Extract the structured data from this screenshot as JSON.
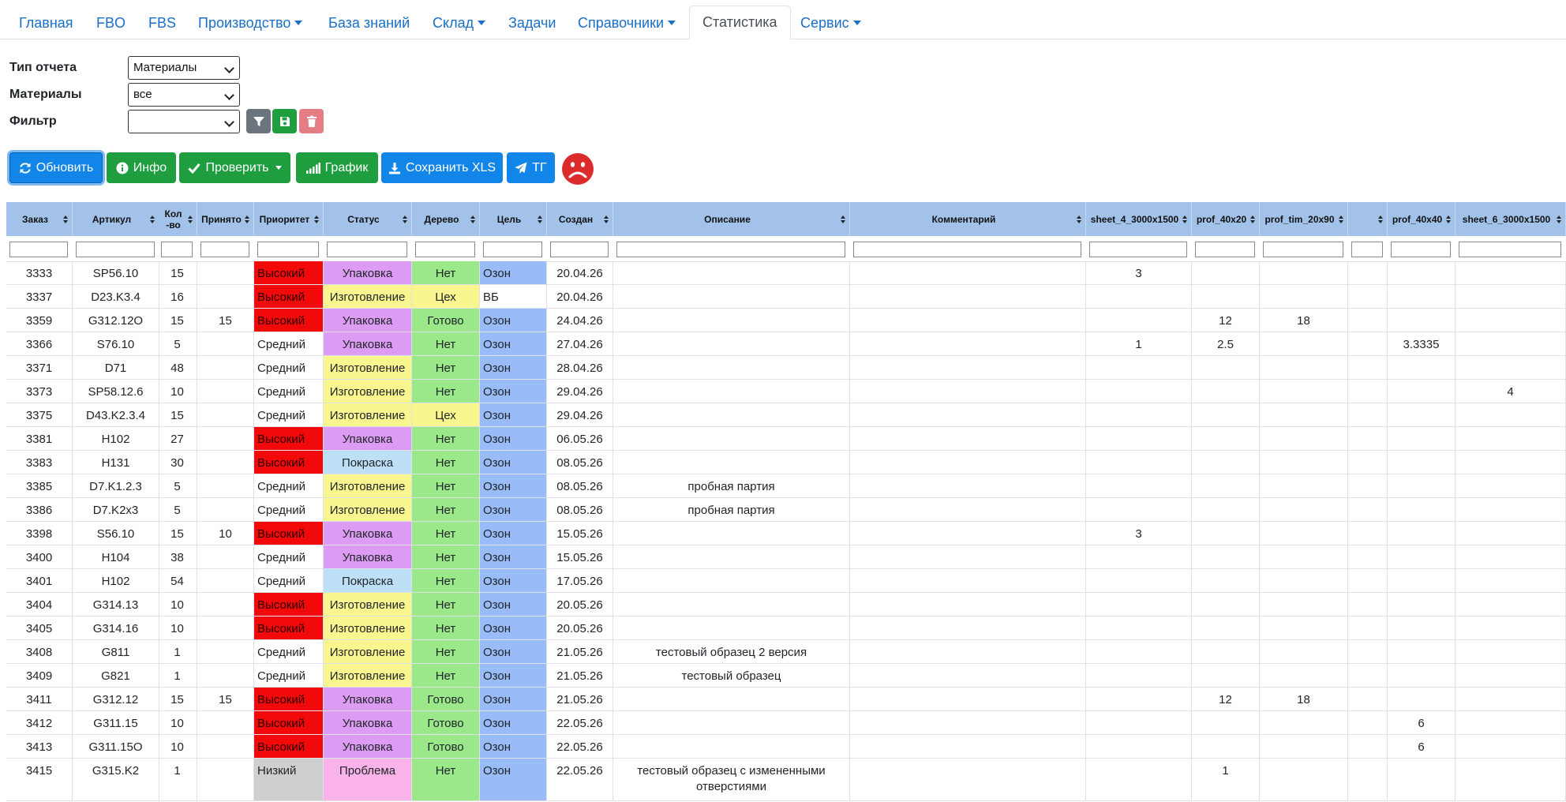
{
  "nav": {
    "items": [
      {
        "label": "Главная",
        "dropdown": false,
        "active": false
      },
      {
        "label": "FBO",
        "dropdown": false,
        "active": false
      },
      {
        "label": "FBS",
        "dropdown": false,
        "active": false
      },
      {
        "label": "Производство",
        "dropdown": true,
        "active": false
      },
      {
        "label": "База знаний",
        "dropdown": false,
        "active": false
      },
      {
        "label": "Склад",
        "dropdown": true,
        "active": false
      },
      {
        "label": "Задачи",
        "dropdown": false,
        "active": false
      },
      {
        "label": "Справочники",
        "dropdown": true,
        "active": false
      },
      {
        "label": "Статистика",
        "dropdown": false,
        "active": true
      },
      {
        "label": "Сервис",
        "dropdown": true,
        "active": false
      }
    ]
  },
  "filters": {
    "report_type_label": "Тип отчета",
    "report_type_value": "Материалы",
    "materials_label": "Материалы",
    "materials_value": "все",
    "filter_label": "Фильтр",
    "filter_value": ""
  },
  "toolbar": {
    "refresh": "Обновить",
    "info": "Инфо",
    "check": "Проверить",
    "chart": "График",
    "save_xls": "Сохранить XLS",
    "telegram": "ТГ"
  },
  "colors": {
    "accent_blue": "#1186e8",
    "green": "#1e9e3e",
    "status_indicator": "#dc2b2b"
  },
  "table": {
    "columns": [
      {
        "label": "Заказ"
      },
      {
        "label": "Артикул"
      },
      {
        "label": "Кол-во"
      },
      {
        "label": "Принято"
      },
      {
        "label": "Приоритет"
      },
      {
        "label": "Статус"
      },
      {
        "label": "Дерево"
      },
      {
        "label": "Цель"
      },
      {
        "label": "Создан"
      },
      {
        "label": "Описание"
      },
      {
        "label": "Комментарий"
      },
      {
        "label": "sheet_4_3000x1500"
      },
      {
        "label": "prof_40x20"
      },
      {
        "label": "prof_tim_20x90"
      },
      {
        "label": ""
      },
      {
        "label": "prof_40x40"
      },
      {
        "label": "sheet_6_3000x1500"
      }
    ],
    "rows": [
      [
        "3333",
        "SP56.10",
        "15",
        "",
        "Высокий",
        "Упаковка",
        "Нет",
        "Озон",
        "20.04.26",
        "",
        "",
        "3",
        "",
        "",
        "",
        "",
        ""
      ],
      [
        "3337",
        "D23.K3.4",
        "16",
        "",
        "Высокий",
        "Изготовление",
        "Цех",
        "ВБ",
        "20.04.26",
        "",
        "",
        "",
        "",
        "",
        "",
        "",
        ""
      ],
      [
        "3359",
        "G312.12О",
        "15",
        "15",
        "Высокий",
        "Упаковка",
        "Готово",
        "Озон",
        "24.04.26",
        "",
        "",
        "",
        "12",
        "18",
        "",
        "",
        ""
      ],
      [
        "3366",
        "S76.10",
        "5",
        "",
        "Средний",
        "Упаковка",
        "Нет",
        "Озон",
        "27.04.26",
        "",
        "",
        "1",
        "2.5",
        "",
        "",
        "3.3335",
        ""
      ],
      [
        "3371",
        "D71",
        "48",
        "",
        "Средний",
        "Изготовление",
        "Нет",
        "Озон",
        "28.04.26",
        "",
        "",
        "",
        "",
        "",
        "",
        "",
        ""
      ],
      [
        "3373",
        "SP58.12.6",
        "10",
        "",
        "Средний",
        "Изготовление",
        "Нет",
        "Озон",
        "29.04.26",
        "",
        "",
        "",
        "",
        "",
        "",
        "",
        "4"
      ],
      [
        "3375",
        "D43.K2.3.4",
        "15",
        "",
        "Средний",
        "Изготовление",
        "Цех",
        "Озон",
        "29.04.26",
        "",
        "",
        "",
        "",
        "",
        "",
        "",
        ""
      ],
      [
        "3381",
        "H102",
        "27",
        "",
        "Высокий",
        "Упаковка",
        "Нет",
        "Озон",
        "06.05.26",
        "",
        "",
        "",
        "",
        "",
        "",
        "",
        ""
      ],
      [
        "3383",
        "H131",
        "30",
        "",
        "Высокий",
        "Покраска",
        "Нет",
        "Озон",
        "08.05.26",
        "",
        "",
        "",
        "",
        "",
        "",
        "",
        ""
      ],
      [
        "3385",
        "D7.K1.2.3",
        "5",
        "",
        "Средний",
        "Изготовление",
        "Нет",
        "Озон",
        "08.05.26",
        "пробная партия",
        "",
        "",
        "",
        "",
        "",
        "",
        ""
      ],
      [
        "3386",
        "D7.K2x3",
        "5",
        "",
        "Средний",
        "Изготовление",
        "Нет",
        "Озон",
        "08.05.26",
        "пробная партия",
        "",
        "",
        "",
        "",
        "",
        "",
        ""
      ],
      [
        "3398",
        "S56.10",
        "15",
        "10",
        "Высокий",
        "Упаковка",
        "Нет",
        "Озон",
        "15.05.26",
        "",
        "",
        "3",
        "",
        "",
        "",
        "",
        ""
      ],
      [
        "3400",
        "H104",
        "38",
        "",
        "Средний",
        "Упаковка",
        "Нет",
        "Озон",
        "15.05.26",
        "",
        "",
        "",
        "",
        "",
        "",
        "",
        ""
      ],
      [
        "3401",
        "H102",
        "54",
        "",
        "Средний",
        "Покраска",
        "Нет",
        "Озон",
        "17.05.26",
        "",
        "",
        "",
        "",
        "",
        "",
        "",
        ""
      ],
      [
        "3404",
        "G314.13",
        "10",
        "",
        "Высокий",
        "Изготовление",
        "Нет",
        "Озон",
        "20.05.26",
        "",
        "",
        "",
        "",
        "",
        "",
        "",
        ""
      ],
      [
        "3405",
        "G314.16",
        "10",
        "",
        "Высокий",
        "Изготовление",
        "Нет",
        "Озон",
        "20.05.26",
        "",
        "",
        "",
        "",
        "",
        "",
        "",
        ""
      ],
      [
        "3408",
        "G811",
        "1",
        "",
        "Средний",
        "Изготовление",
        "Нет",
        "Озон",
        "21.05.26",
        "тестовый образец 2 версия",
        "",
        "",
        "",
        "",
        "",
        "",
        ""
      ],
      [
        "3409",
        "G821",
        "1",
        "",
        "Средний",
        "Изготовление",
        "Нет",
        "Озон",
        "21.05.26",
        "тестовый образец",
        "",
        "",
        "",
        "",
        "",
        "",
        ""
      ],
      [
        "3411",
        "G312.12",
        "15",
        "15",
        "Высокий",
        "Упаковка",
        "Готово",
        "Озон",
        "21.05.26",
        "",
        "",
        "",
        "12",
        "18",
        "",
        "",
        ""
      ],
      [
        "3412",
        "G311.15",
        "10",
        "",
        "Высокий",
        "Упаковка",
        "Готово",
        "Озон",
        "22.05.26",
        "",
        "",
        "",
        "",
        "",
        "",
        "6",
        ""
      ],
      [
        "3413",
        "G311.15О",
        "10",
        "",
        "Высокий",
        "Упаковка",
        "Готово",
        "Озон",
        "22.05.26",
        "",
        "",
        "",
        "",
        "",
        "",
        "6",
        ""
      ],
      [
        "3415",
        "G315.K2",
        "1",
        "",
        "Низкий",
        "Проблема",
        "Нет",
        "Озон",
        "22.05.26",
        "тестовый образец с измененными отверстиями",
        "",
        "",
        "1",
        "",
        "",
        "",
        ""
      ]
    ]
  }
}
